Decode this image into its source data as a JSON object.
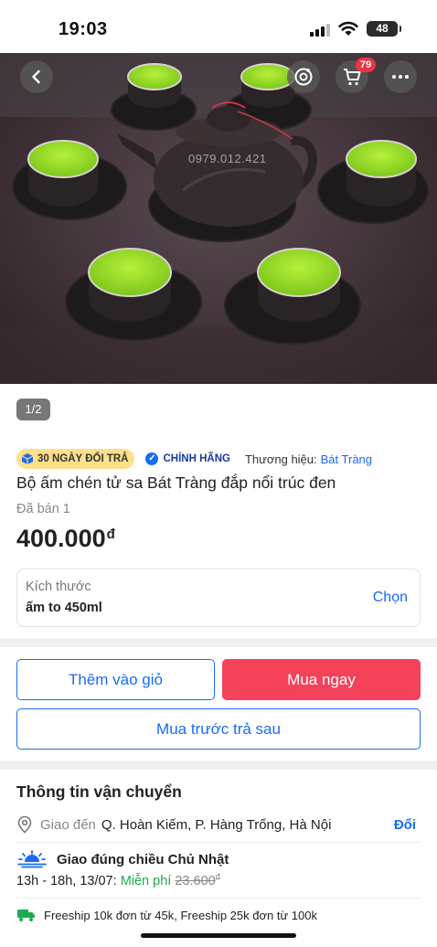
{
  "status_bar": {
    "time": "19:03",
    "battery": "48"
  },
  "hero": {
    "watermark": "0979.012.421",
    "cart_badge": "79",
    "page_counter": "1/2",
    "icons": [
      "back-arrow-icon",
      "ar-view-icon",
      "cart-icon",
      "more-icon"
    ]
  },
  "badges": {
    "return_policy": "30 NGÀY ĐỔI TRẢ",
    "genuine": "CHÍNH HÃNG",
    "brand_label": "Thương hiệu:",
    "brand_name": "Bát Tràng"
  },
  "product": {
    "title": "Bộ ấm chén tử sa Bát Tràng đắp nổi trúc đen",
    "sold": "Đã bán 1",
    "price": "400.000",
    "currency": "đ"
  },
  "variant": {
    "label": "Kích thước",
    "value": "ấm to 450ml",
    "choose": "Chọn"
  },
  "actions": {
    "add_to_cart": "Thêm vào giỏ",
    "buy_now": "Mua ngay",
    "buy_pay_later": "Mua trước trả sau"
  },
  "shipping": {
    "title": "Thông tin vận chuyển",
    "ship_to_label": "Giao đến",
    "address": "Q. Hoàn Kiếm, P. Hàng Trống, Hà Nội",
    "change": "Đổi",
    "delivery_title": "Giao đúng chiều Chủ Nhật",
    "delivery_time": "13h - 18h, 13/07:",
    "free_label": "Miễn phí",
    "old_fee": "23.600",
    "old_fee_currency": "đ",
    "freeship_note": "Freeship 10k đơn từ 45k, Freeship 25k đơn từ 100k"
  },
  "colors": {
    "accent_blue": "#1a6cf2",
    "buy_red": "#f4425a",
    "free_green": "#1eaa4f",
    "badge_yellow": "#ffe08a"
  }
}
